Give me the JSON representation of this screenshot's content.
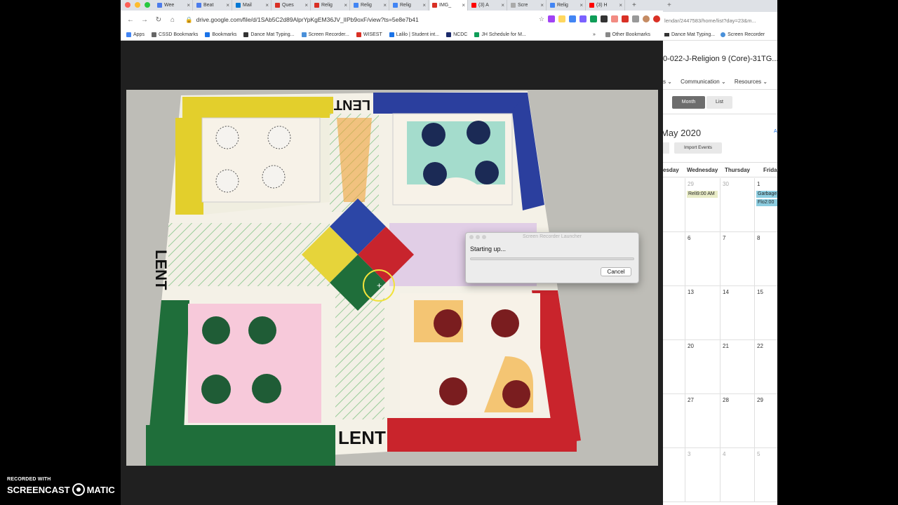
{
  "browser": {
    "tabs": [
      {
        "label": "Wee",
        "icon": "wordpress-icon",
        "color": "#4b7bec"
      },
      {
        "label": "Beat",
        "icon": "wordpress-icon",
        "color": "#4b7bec"
      },
      {
        "label": "Mail",
        "icon": "outlook-icon",
        "color": "#0078d4"
      },
      {
        "label": "Ques",
        "icon": "page-icon",
        "color": "#d93025"
      },
      {
        "label": "Relig",
        "icon": "gmail-icon",
        "color": "#d93025"
      },
      {
        "label": "Relig",
        "icon": "docs-icon",
        "color": "#4285f4"
      },
      {
        "label": "Relig",
        "icon": "docs-icon",
        "color": "#4285f4"
      },
      {
        "label": "IMG_",
        "icon": "image-icon",
        "color": "#d93025"
      },
      {
        "label": "(3) A",
        "icon": "youtube-icon",
        "color": "#ff0000"
      },
      {
        "label": "Scre",
        "icon": "screencast-icon",
        "color": "#aaaaaa"
      },
      {
        "label": "Relig",
        "icon": "docs-icon",
        "color": "#4285f4"
      },
      {
        "label": "(3) H",
        "icon": "youtube-icon",
        "color": "#ff0000"
      }
    ],
    "active_tab_index": 7,
    "url": "drive.google.com/file/d/1SAb5C2d89AlprYpKgEM36JV_lIPb9oxF/view?ts=5e8e7b41",
    "bookmarks": [
      {
        "label": "Apps",
        "icon": "apps-grid-icon",
        "color": "#4285f4"
      },
      {
        "label": "CSSD Bookmarks",
        "icon": "folder-icon",
        "color": "#666666"
      },
      {
        "label": "Bookmarks",
        "icon": "star-icon",
        "color": "#1a73e8"
      },
      {
        "label": "Dance Mat Typing...",
        "icon": "page-icon",
        "color": "#333333"
      },
      {
        "label": "Screen Recorder...",
        "icon": "screencast-icon",
        "color": "#4a90d9"
      },
      {
        "label": "WISEST",
        "icon": "pdf-icon",
        "color": "#d93025"
      },
      {
        "label": "Lalilo | Student int...",
        "icon": "globe-icon",
        "color": "#1a73e8"
      },
      {
        "label": "NCDC",
        "icon": "n-icon",
        "color": "#1b2a6b"
      },
      {
        "label": "JH Schedule for M...",
        "icon": "sheets-icon",
        "color": "#0f9d58"
      }
    ],
    "other_bookmarks": "Other Bookmarks"
  },
  "dialog": {
    "title": "Screen Recorder Launcher",
    "message": "Starting up...",
    "cancel_label": "Cancel"
  },
  "board": {
    "top_label": "LENT",
    "left_label": "LENT",
    "bottom_label": "LENT"
  },
  "right_window": {
    "url": "lendar/2447583/home/list?day=23&m...",
    "bookmarks": [
      {
        "label": "Dance Mat Typing...",
        "icon": "page-icon"
      },
      {
        "label": "Screen Recorder",
        "icon": "screencast-icon"
      }
    ],
    "course_title": "0-022-J-Religion 9 (Core)-31TG...",
    "menu": [
      "s ⌄",
      "Communication ⌄",
      "Resources ⌄"
    ],
    "view_month": "Month",
    "view_list": "List",
    "month_title": "May 2020",
    "side_link": "A",
    "import_events": "Import Events",
    "day_headers": [
      "esday",
      "Wednesday",
      "Thursday",
      "Frida"
    ],
    "weeks": [
      {
        "wed": "29",
        "thu": "30",
        "fri": "1",
        "muted": true
      },
      {
        "wed": "6",
        "thu": "7",
        "fri": "8",
        "muted": false
      },
      {
        "wed": "13",
        "thu": "14",
        "fri": "15",
        "muted": false
      },
      {
        "wed": "20",
        "thu": "21",
        "fri": "22",
        "muted": false
      },
      {
        "wed": "27",
        "thu": "28",
        "fri": "29",
        "muted": false
      },
      {
        "wed": "3",
        "thu": "4",
        "fri": "5",
        "muted": true
      }
    ],
    "events": [
      {
        "label": "Reli9:00 AM",
        "color": "#e9ecc7"
      },
      {
        "label": "Garbage",
        "color": "#8ccde0"
      },
      {
        "label": "Flo2:00",
        "color": "#8ccde0"
      }
    ]
  },
  "watermark": {
    "line1": "RECORDED WITH",
    "brand_left": "SCREENCAST",
    "brand_right": "MATIC"
  }
}
